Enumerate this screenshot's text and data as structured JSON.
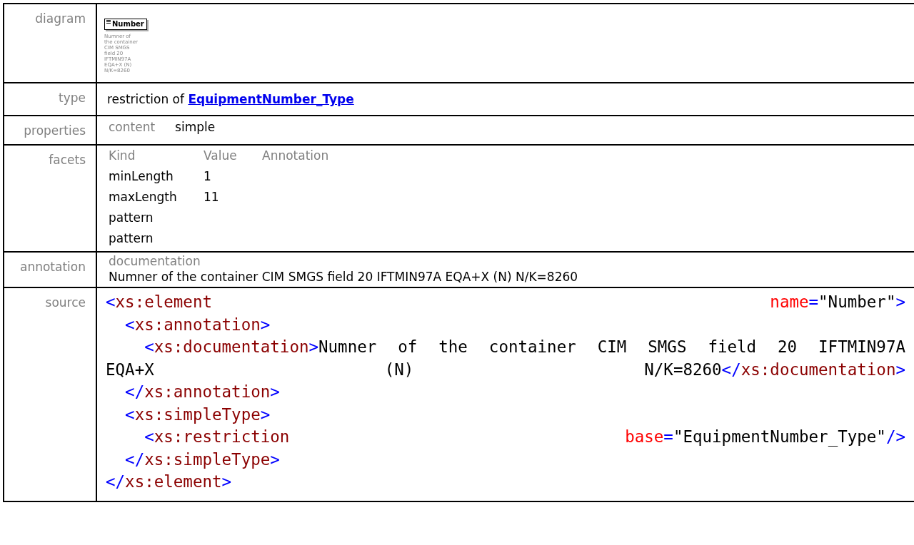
{
  "rows": [
    {
      "kind": "diagram",
      "label": "diagram",
      "element": {
        "name": "Number",
        "caption_lines": [
          "Numner of",
          "the container",
          "CIM SMGS",
          "field 20",
          "IFTMIN97A",
          "EQA+X (N)",
          "N/K=8260"
        ]
      }
    },
    {
      "kind": "type",
      "label": "type",
      "prefix": "restriction of",
      "link": "EquipmentNumber_Type"
    },
    {
      "kind": "properties",
      "label": "properties",
      "items": [
        {
          "name": "content",
          "value": "simple"
        }
      ]
    },
    {
      "kind": "facets",
      "label": "facets",
      "columns": [
        "Kind",
        "Value",
        "Annotation"
      ],
      "facets": [
        {
          "kind": "minLength",
          "value": "1"
        },
        {
          "kind": "maxLength",
          "value": "11"
        },
        {
          "kind": "pattern"
        },
        {
          "kind": "pattern"
        }
      ]
    },
    {
      "kind": "annotation",
      "label": "annotation",
      "heading": "documentation",
      "text": "Numner of the container CIM SMGS field 20 IFTMIN97A EQA+X (N) N/K=8260"
    },
    {
      "kind": "source",
      "label": "source",
      "lines": [
        {
          "parts": [
            "<xs:element",
            "name=\"Number\">"
          ]
        },
        {
          "text": "  <xs:annotation>"
        },
        {
          "justify": true,
          "text": "    <xs:documentation>Numner of the container CIM SMGS field 20 IFTMIN97A"
        },
        {
          "justify": true,
          "text": "EQA+X (N) N/K=8260</xs:documentation>"
        },
        {
          "text": "  </xs:annotation>"
        },
        {
          "text": "  <xs:simpleType>"
        },
        {
          "parts": [
            "    <xs:restriction",
            "base=\"EquipmentNumber_Type\"/>"
          ]
        },
        {
          "text": "  </xs:simpleType>"
        },
        {
          "text": "</xs:element>"
        }
      ]
    }
  ]
}
